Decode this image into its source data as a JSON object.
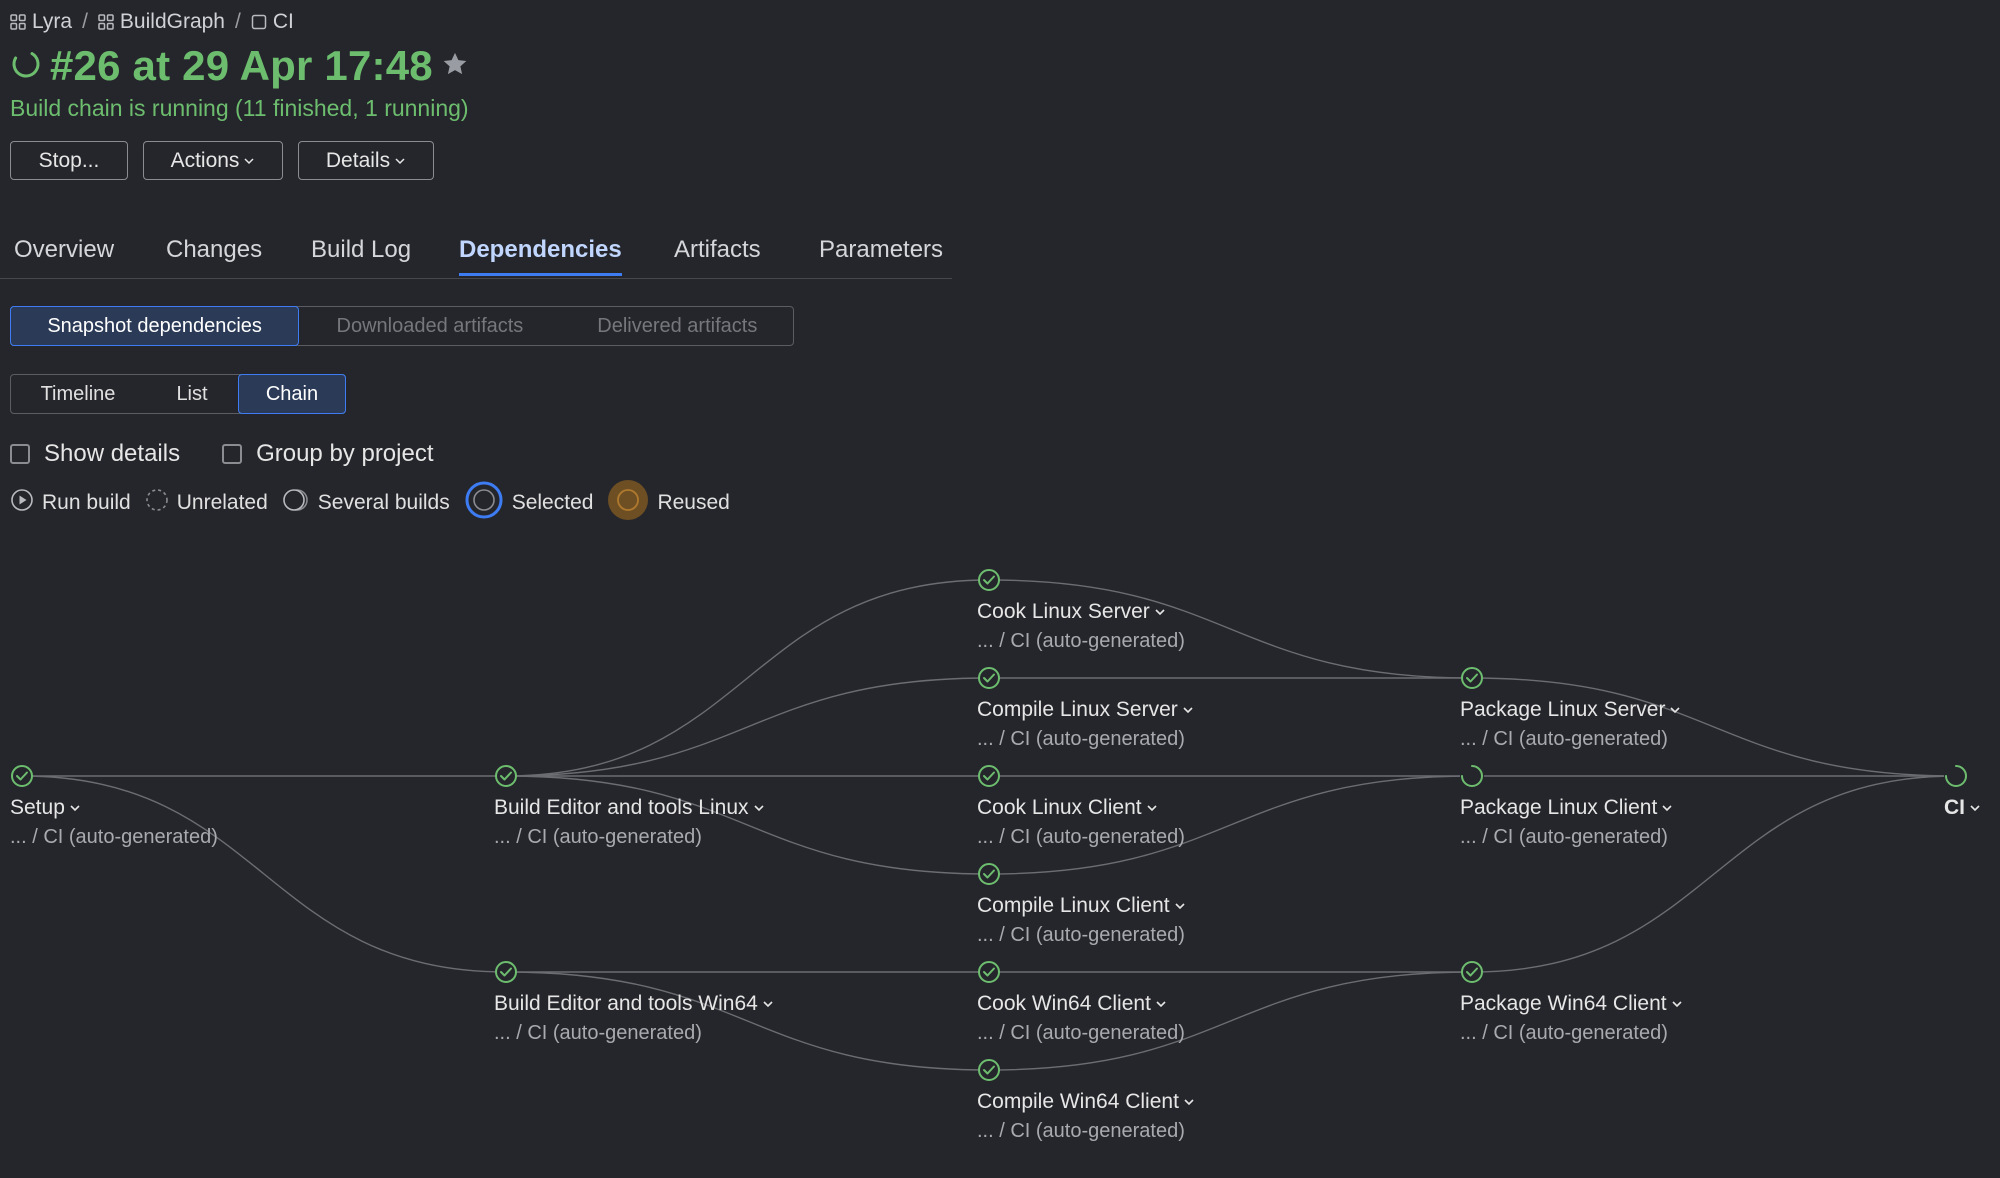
{
  "breadcrumb": {
    "items": [
      {
        "label": "Lyra",
        "icon": "project-grid-icon"
      },
      {
        "label": "BuildGraph",
        "icon": "project-grid-icon"
      },
      {
        "label": "CI",
        "icon": "build-config-icon"
      }
    ],
    "separator": "/"
  },
  "header": {
    "title": "#26 at 29 Apr 17:48",
    "status": "Build chain is running (11 finished, 1 running)"
  },
  "toolbar": {
    "stop_label": "Stop...",
    "actions_label": "Actions",
    "details_label": "Details"
  },
  "tabs": [
    {
      "label": "Overview"
    },
    {
      "label": "Changes"
    },
    {
      "label": "Build Log"
    },
    {
      "label": "Dependencies",
      "active": true
    },
    {
      "label": "Artifacts"
    },
    {
      "label": "Parameters"
    }
  ],
  "dep_types": [
    {
      "label": "Snapshot dependencies",
      "active": true
    },
    {
      "label": "Downloaded artifacts",
      "disabled": true
    },
    {
      "label": "Delivered artifacts",
      "disabled": true
    }
  ],
  "views": [
    {
      "label": "Timeline"
    },
    {
      "label": "List"
    },
    {
      "label": "Chain",
      "active": true
    }
  ],
  "options": {
    "show_details": "Show details",
    "group_by_project": "Group by project"
  },
  "legend": {
    "run_build": "Run build",
    "unrelated": "Unrelated",
    "several_builds": "Several builds",
    "selected": "Selected",
    "reused": "Reused"
  },
  "colors": {
    "success": "#6dbd6f",
    "accent": "#3d7cf3",
    "reused": "#b07a2e",
    "edge": "#6b6d73"
  },
  "nodes": [
    {
      "id": "setup",
      "name": "Setup",
      "sub": "... / CI (auto-generated)",
      "status": "success"
    },
    {
      "id": "bel",
      "name": "Build Editor and tools Linux",
      "sub": "... / CI (auto-generated)",
      "status": "success"
    },
    {
      "id": "bew",
      "name": "Build Editor and tools Win64",
      "sub": "... / CI (auto-generated)",
      "status": "success"
    },
    {
      "id": "cls",
      "name": "Cook Linux Server",
      "sub": "... / CI (auto-generated)",
      "status": "success"
    },
    {
      "id": "cols",
      "name": "Compile Linux Server",
      "sub": "... / CI (auto-generated)",
      "status": "success"
    },
    {
      "id": "clc",
      "name": "Cook Linux Client",
      "sub": "... / CI (auto-generated)",
      "status": "success"
    },
    {
      "id": "colc",
      "name": "Compile Linux Client",
      "sub": "... / CI (auto-generated)",
      "status": "success"
    },
    {
      "id": "cwc",
      "name": "Cook Win64 Client",
      "sub": "... / CI (auto-generated)",
      "status": "success"
    },
    {
      "id": "cowc",
      "name": "Compile Win64 Client",
      "sub": "... / CI (auto-generated)",
      "status": "success"
    },
    {
      "id": "pls",
      "name": "Package Linux Server",
      "sub": "... / CI (auto-generated)",
      "status": "success"
    },
    {
      "id": "plc",
      "name": "Package Linux Client",
      "sub": "... / CI (auto-generated)",
      "status": "running"
    },
    {
      "id": "pwc",
      "name": "Package Win64 Client",
      "sub": "... / CI (auto-generated)",
      "status": "success"
    },
    {
      "id": "ci",
      "name": "CI",
      "sub": "",
      "status": "running",
      "bold": true
    }
  ],
  "edges": [
    [
      "setup",
      "bel"
    ],
    [
      "setup",
      "bew"
    ],
    [
      "bel",
      "cls"
    ],
    [
      "bel",
      "cols"
    ],
    [
      "bel",
      "clc"
    ],
    [
      "bel",
      "colc"
    ],
    [
      "bew",
      "cwc"
    ],
    [
      "bew",
      "cowc"
    ],
    [
      "cls",
      "pls"
    ],
    [
      "cols",
      "pls"
    ],
    [
      "clc",
      "plc"
    ],
    [
      "colc",
      "plc"
    ],
    [
      "cwc",
      "pwc"
    ],
    [
      "cowc",
      "pwc"
    ],
    [
      "pls",
      "ci"
    ],
    [
      "plc",
      "ci"
    ],
    [
      "pwc",
      "ci"
    ]
  ]
}
